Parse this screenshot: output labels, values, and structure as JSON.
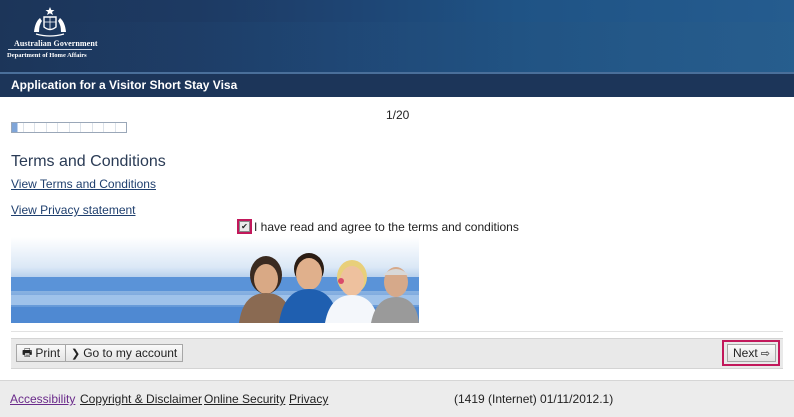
{
  "header": {
    "gov_line1": "Australian Government",
    "gov_line2": "Department of Home Affairs",
    "crest_icon": "coat-of-arms-icon",
    "colors": {
      "brand": "#1c3559",
      "accent": "#c2185b"
    }
  },
  "titlebar": {
    "title": "Application for a Visitor Short Stay Visa"
  },
  "progress": {
    "page_label": "1/20",
    "current": 1,
    "total": 20,
    "segments": 10,
    "filled": 0.5
  },
  "main": {
    "section_title": "Terms and Conditions",
    "terms_link": "View Terms and Conditions",
    "privacy_link": "View Privacy statement",
    "agree_label": "I have read and agree to the terms and conditions",
    "agree_checked": true
  },
  "actions": {
    "print_label": "Print",
    "print_icon": "printer-icon",
    "account_label": "Go to my account",
    "account_icon": "chevron-right-icon",
    "next_label": "Next",
    "next_icon": "arrow-right-icon"
  },
  "footer": {
    "links": [
      "Accessibility",
      "Copyright & Disclaimer",
      "Online Security",
      "Privacy"
    ],
    "version": "(1419 (Internet) 01/11/2012.1)"
  }
}
